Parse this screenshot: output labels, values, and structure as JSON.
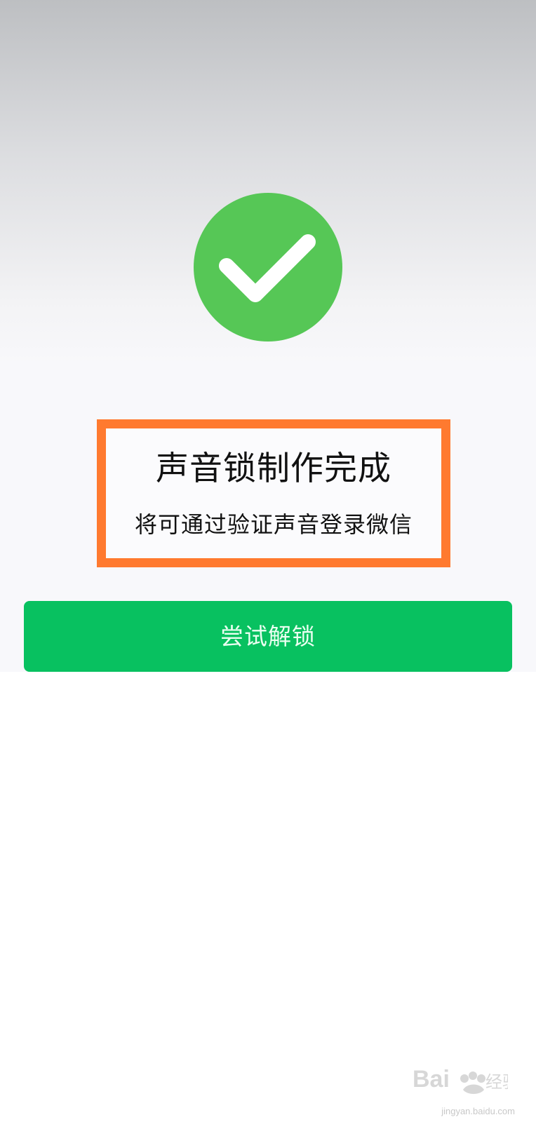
{
  "content": {
    "success_icon": "check-circle-icon",
    "title": "声音锁制作完成",
    "subtitle": "将可通过验证声音登录微信"
  },
  "actions": {
    "try_unlock_label": "尝试解锁"
  },
  "watermark": {
    "brand": "Baidu经验",
    "url": "jingyan.baidu.com"
  },
  "colors": {
    "success": "#56c756",
    "button": "#08c160",
    "highlight": "#ff7a2f"
  }
}
